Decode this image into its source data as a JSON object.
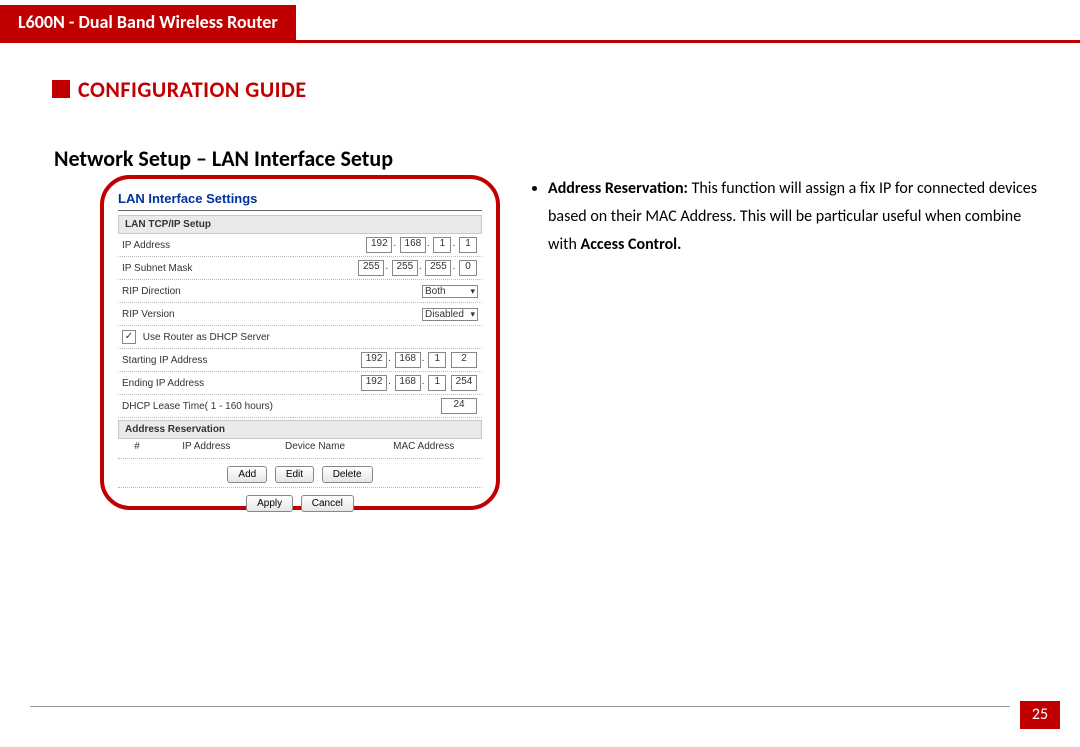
{
  "header": {
    "product": "L600N - Dual Band Wireless Router"
  },
  "guide_title": "CONFIGURATION GUIDE",
  "section_title": "Network Setup – LAN Interface Setup",
  "description": {
    "bullet_lead": "Address Reservation:",
    "bullet_text_1": " This function will assign a fix IP for connected devices based on their MAC Address. This will be particular useful when combine with ",
    "bold_tail": "Access Control.",
    "bullet_text_2": ""
  },
  "panel": {
    "title": "LAN Interface Settings",
    "tcp_header": "LAN TCP/IP Setup",
    "rows": {
      "ip_label": "IP Address",
      "ip_oct": [
        "192",
        "168",
        "1",
        "1"
      ],
      "mask_label": "IP Subnet Mask",
      "mask_oct": [
        "255",
        "255",
        "255",
        "0"
      ],
      "rip_dir_label": "RIP Direction",
      "rip_dir_val": "Both",
      "rip_ver_label": "RIP Version",
      "rip_ver_val": "Disabled",
      "dhcp_chk_label": "Use Router as DHCP Server",
      "start_label": "Starting IP Address",
      "start_oct": [
        "192",
        "168",
        "1",
        "2"
      ],
      "end_label": "Ending IP Address",
      "end_oct": [
        "192",
        "168",
        "1",
        "254"
      ],
      "lease_label": "DHCP Lease Time( 1 - 160 hours)",
      "lease_val": "24"
    },
    "resv_header": "Address Reservation",
    "resv_cols": {
      "c1": "#",
      "c2": "IP Address",
      "c3": "Device Name",
      "c4": "MAC Address"
    },
    "btns": {
      "add": "Add",
      "edit": "Edit",
      "del": "Delete",
      "apply": "Apply",
      "cancel": "Cancel"
    }
  },
  "page_number": "25"
}
